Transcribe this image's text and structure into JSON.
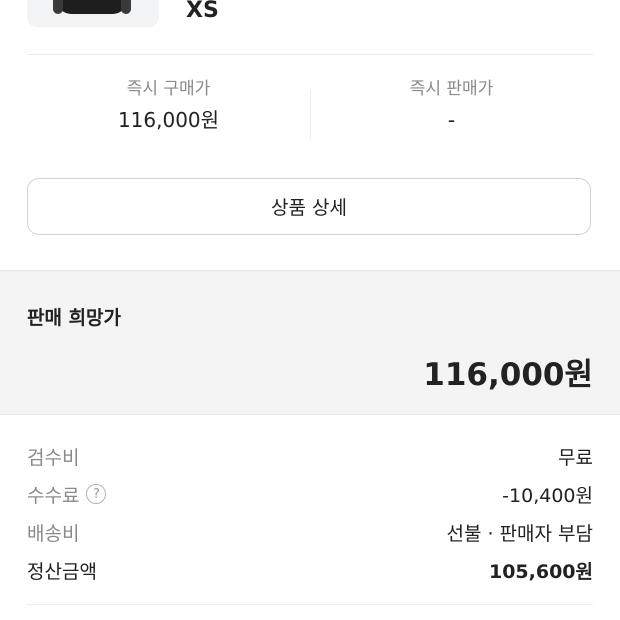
{
  "product": {
    "size": "XS",
    "thumbnail_icon": "product-image"
  },
  "prices": {
    "buy_label": "즉시 구매가",
    "buy_value": "116,000원",
    "sell_label": "즉시 판매가",
    "sell_value": "-"
  },
  "detail_button": {
    "label": "상품 상세"
  },
  "desired_price": {
    "label": "판매 희망가",
    "value": "116,000원"
  },
  "fees": {
    "inspection": {
      "label": "검수비",
      "value": "무료"
    },
    "commission": {
      "label": "수수료",
      "value": "-10,400원",
      "help_icon": "?"
    },
    "shipping": {
      "label": "배송비",
      "value": "선불 · 판매자 부담"
    },
    "settlement": {
      "label": "정산금액",
      "value": "105,600원"
    }
  },
  "colors": {
    "text_primary": "#222222",
    "text_secondary": "#8a8a8a",
    "section_bg": "#f4f4f4",
    "border": "#d3d3d3"
  }
}
